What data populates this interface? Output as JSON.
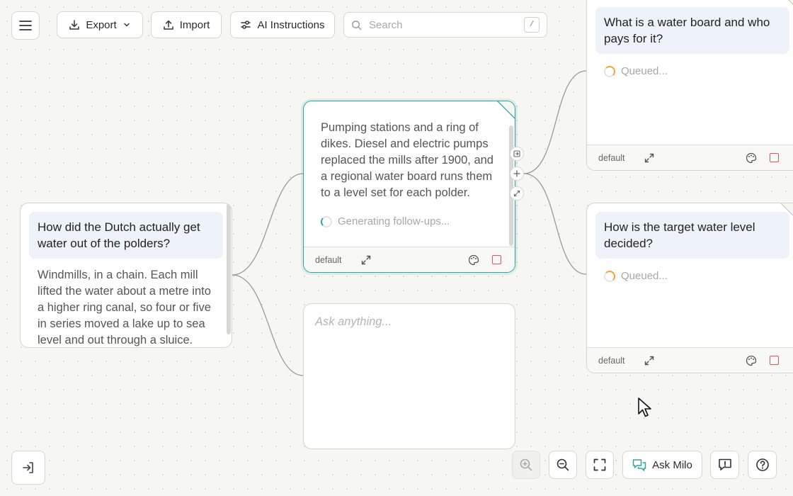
{
  "toolbar": {
    "export_label": "Export",
    "import_label": "Import",
    "ai_label": "AI Instructions",
    "search_placeholder": "Search",
    "search_value": "",
    "search_shortcut": "/"
  },
  "cards": {
    "root": {
      "question": "How did the Dutch actually get water out of the polders?",
      "answer": "Windmills, in a chain. Each mill lifted the water about a metre into a higher ring canal, so four or five in series moved a lake up to sea level and out through a sluice."
    },
    "active": {
      "answer": "Pumping stations and a ring of dikes. Diesel and electric pumps replaced the mills after 1900, and a regional water board runs them to a level set for each polder.",
      "status": "Generating follow-ups...",
      "footer_label": "default"
    },
    "ask": {
      "placeholder": "Ask anything...",
      "value": ""
    },
    "followup1": {
      "question": "What is a water board and who pays for it?",
      "status": "Queued...",
      "footer_label": "default"
    },
    "followup2": {
      "question": "How is the target water level decided?",
      "status": "Queued...",
      "footer_label": "default"
    }
  },
  "bottom": {
    "ask_milo_label": "Ask Milo"
  },
  "colors": {
    "accent": "#2ea59f",
    "question_bg": "#eef3fa",
    "stop": "#e05555",
    "spinner_queued": "#f2a33a"
  }
}
